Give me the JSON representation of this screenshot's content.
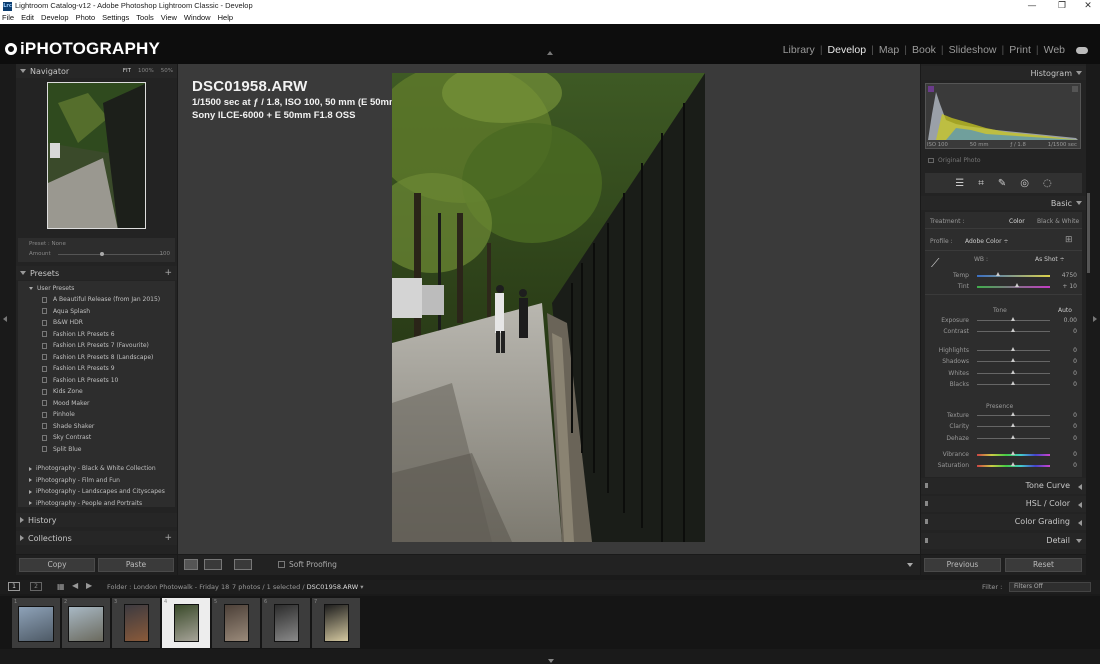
{
  "window": {
    "title": "Lightroom Catalog-v12 - Adobe Photoshop Lightroom Classic - Develop",
    "app_icon": "Lrc",
    "minimize": "—",
    "maximize": "❐",
    "close": "✕"
  },
  "menubar": [
    "File",
    "Edit",
    "Develop",
    "Photo",
    "Settings",
    "Tools",
    "View",
    "Window",
    "Help"
  ],
  "identity_plate": "iPHOTOGRAPHY",
  "modules": [
    "Library",
    "Develop",
    "Map",
    "Book",
    "Slideshow",
    "Print",
    "Web"
  ],
  "active_module": "Develop",
  "navigator": {
    "title": "Navigator",
    "zoom": [
      "FIT",
      "100%",
      "50%"
    ]
  },
  "preset_amount": {
    "preset_label": "Preset : None",
    "amount_label": "Amount",
    "amount_value": "100",
    "amount_fraction": 0.5
  },
  "presets": {
    "title": "Presets",
    "plus": "+",
    "user_group": "User Presets",
    "user_items": [
      "A Beautiful Release (from Jan 2015)",
      "Aqua Splash",
      "B&W HDR",
      "Fashion LR Presets 6",
      "Fashion LR Presets 7 (Favourite)",
      "Fashion LR Presets 8 (Landscape)",
      "Fashion LR Presets 9",
      "Fashion LR Presets 10",
      "Kids Zone",
      "Mood Maker",
      "Pinhole",
      "Shade Shaker",
      "Sky Contrast",
      "Split Blue"
    ],
    "collections": [
      "iPhotography - Black & White Collection",
      "iPhotography - Film and Fun",
      "iPhotography - Landscapes and Cityscapes",
      "iPhotography - People and Portraits"
    ]
  },
  "history": {
    "title": "History"
  },
  "collections": {
    "title": "Collections",
    "plus": "+"
  },
  "left_buttons": {
    "copy": "Copy",
    "paste": "Paste"
  },
  "photo_info": {
    "filename": "DSC01958.ARW",
    "exposure": "1/1500 sec at ƒ / 1.8, ISO 100, 50 mm (E 50mm F1.8 OSS)",
    "camera": "Sony ILCE-6000 + E 50mm F1.8 OSS"
  },
  "toolbar": {
    "soft_proofing": "Soft Proofing"
  },
  "histogram": {
    "title": "Histogram",
    "iso": "ISO 100",
    "focal": "50 mm",
    "aperture": "ƒ / 1.8",
    "shutter": "1/1500 sec",
    "original_photo": "Original Photo"
  },
  "basic": {
    "title": "Basic",
    "treatment_label": "Treatment :",
    "treatment_color": "Color",
    "treatment_bw": "Black & White",
    "profile_label": "Profile :",
    "profile_value": "Adobe Color ÷",
    "wb_label": "WB :",
    "wb_value": "As Shot ÷",
    "tone_label": "Tone",
    "auto_label": "Auto",
    "presence_label": "Presence",
    "sliders": [
      {
        "label": "Temp",
        "value": "4750",
        "pos": 0.3
      },
      {
        "label": "Tint",
        "value": "+ 10",
        "pos": 0.55
      },
      {
        "label": "Exposure",
        "value": "0.00",
        "pos": 0.5
      },
      {
        "label": "Contrast",
        "value": "0",
        "pos": 0.5
      },
      {
        "label": "Highlights",
        "value": "0",
        "pos": 0.5
      },
      {
        "label": "Shadows",
        "value": "0",
        "pos": 0.5
      },
      {
        "label": "Whites",
        "value": "0",
        "pos": 0.5
      },
      {
        "label": "Blacks",
        "value": "0",
        "pos": 0.5
      },
      {
        "label": "Texture",
        "value": "0",
        "pos": 0.5
      },
      {
        "label": "Clarity",
        "value": "0",
        "pos": 0.5
      },
      {
        "label": "Dehaze",
        "value": "0",
        "pos": 0.5
      },
      {
        "label": "Vibrance",
        "value": "0",
        "pos": 0.5
      },
      {
        "label": "Saturation",
        "value": "0",
        "pos": 0.5
      }
    ]
  },
  "right_sections": [
    {
      "label": "Tone Curve"
    },
    {
      "label": "HSL / Color"
    },
    {
      "label": "Color Grading"
    },
    {
      "label": "Detail"
    }
  ],
  "right_buttons": {
    "previous": "Previous",
    "reset": "Reset"
  },
  "filmstrip_bar": {
    "monitor1": "1",
    "monitor2": "2",
    "folder": "Folder : London Photowalk - Friday 18",
    "count": "7 photos / 1 selected /",
    "current": "DSC01958.ARW",
    "filter_label": "Filter :",
    "filter_value": "Filters Off"
  },
  "filmstrip": {
    "numbers": [
      "1",
      "2",
      "3",
      "4",
      "5",
      "6",
      "7"
    ],
    "selected_index": 3
  }
}
